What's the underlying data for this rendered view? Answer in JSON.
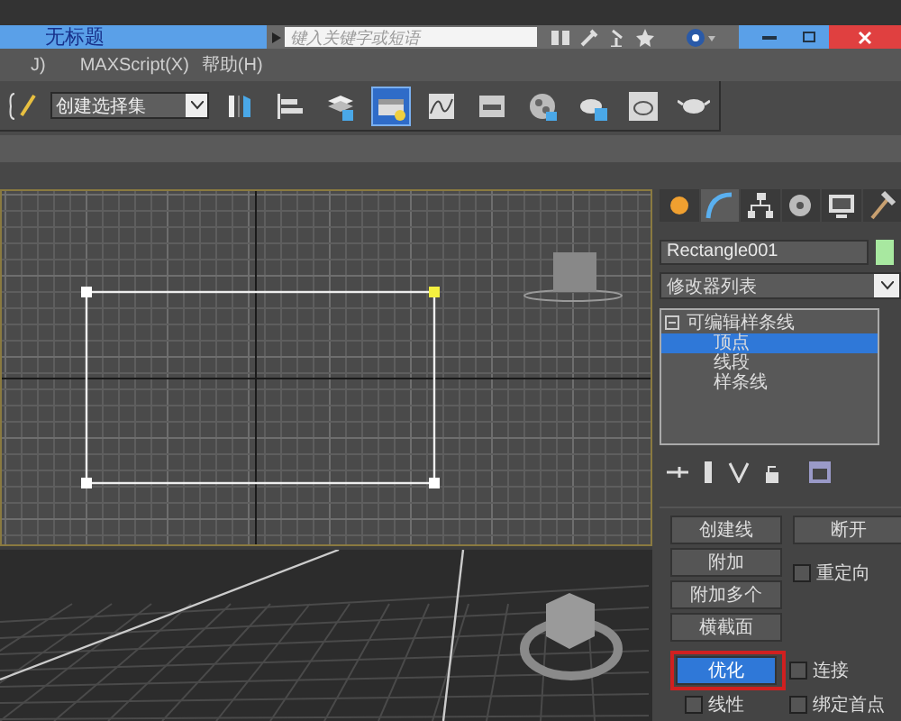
{
  "title_bar": {
    "title": "无标题",
    "search": {
      "placeholder": "键入关键字或短语"
    }
  },
  "menu": [
    {
      "label": "J)"
    },
    {
      "label": "MAXScript(X)"
    },
    {
      "label": "帮助(H)"
    }
  ],
  "toolbar": {
    "selection_set": {
      "value": "创建选择集"
    },
    "tools": [
      {
        "kind": "mirror",
        "selected": false
      },
      {
        "kind": "align",
        "selected": false
      },
      {
        "kind": "layers",
        "selected": false
      },
      {
        "kind": "explorer",
        "selected": true
      },
      {
        "kind": "curve",
        "selected": false
      },
      {
        "kind": "schematic",
        "selected": false
      },
      {
        "kind": "material",
        "selected": false
      },
      {
        "kind": "render_setup",
        "selected": false
      },
      {
        "kind": "render_frame",
        "selected": false
      },
      {
        "kind": "render",
        "selected": false
      }
    ]
  },
  "viewports": [
    {
      "kind": "top",
      "active": true,
      "vertices": [
        {
          "selected": false
        },
        {
          "selected": true
        },
        {
          "selected": false
        },
        {
          "selected": false
        }
      ]
    },
    {
      "kind": "perspective",
      "active": false
    }
  ],
  "command_panel": {
    "tabs": [
      {
        "kind": "create",
        "selected": false
      },
      {
        "kind": "modify",
        "selected": true
      },
      {
        "kind": "hierarchy",
        "selected": false
      },
      {
        "kind": "motion",
        "selected": false
      },
      {
        "kind": "display",
        "selected": false
      },
      {
        "kind": "utilities",
        "selected": false
      }
    ],
    "object_name": "Rectangle001",
    "modifier_list": {
      "value": "修改器列表"
    },
    "stack": [
      {
        "label": "可编辑样条线",
        "expanded": true,
        "selected": false,
        "children": [
          {
            "label": "顶点",
            "selected": true
          },
          {
            "label": "线段",
            "selected": false
          },
          {
            "label": "样条线",
            "selected": false
          }
        ]
      }
    ],
    "geometry": {
      "left": [
        {
          "kind": "button",
          "label": "创建线"
        },
        {
          "kind": "button",
          "label": "附加"
        },
        {
          "kind": "button",
          "label": "附加多个"
        },
        {
          "kind": "button",
          "label": "横截面"
        }
      ],
      "right": [
        {
          "kind": "button",
          "label": "断开"
        },
        {
          "kind": "checkbox",
          "label": "重定向",
          "checked": false
        }
      ]
    },
    "refine": {
      "button": {
        "label": "优化",
        "selected": true,
        "annotated": true
      },
      "options": [
        {
          "label": "连接",
          "checked": false
        },
        {
          "label": "线性",
          "checked": false
        },
        {
          "label": "绑定首点",
          "checked": false
        }
      ]
    }
  }
}
